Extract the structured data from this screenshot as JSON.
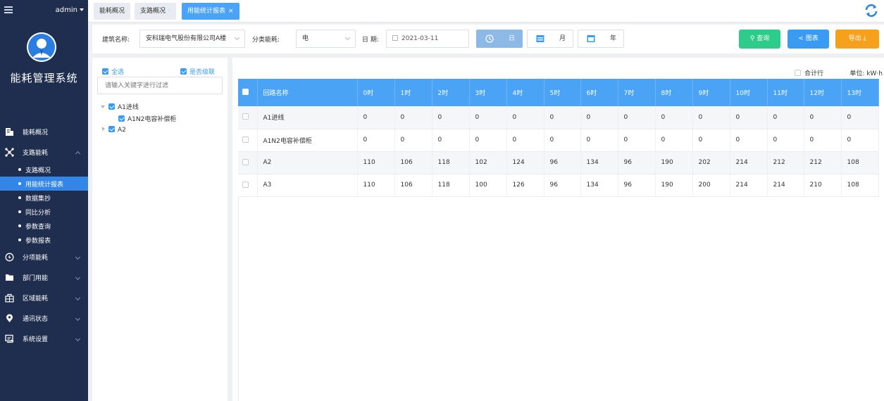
{
  "header": {
    "user": "admin"
  },
  "sidebar": {
    "title": "能耗管理系统",
    "items": [
      {
        "label": "能耗概况",
        "icon": "building-icon"
      },
      {
        "label": "支路能耗",
        "icon": "branch-icon"
      },
      {
        "label": "分项能耗",
        "icon": "power-icon"
      },
      {
        "label": "部门用能",
        "icon": "folder-icon"
      },
      {
        "label": "区域能耗",
        "icon": "region-icon"
      },
      {
        "label": "通讯状态",
        "icon": "location-icon"
      },
      {
        "label": "系统设置",
        "icon": "settings-icon"
      }
    ],
    "subitems": [
      "支路概况",
      "用能统计报表",
      "数据集抄",
      "同比分析",
      "参数查询",
      "参数报表"
    ],
    "active_subitem": "用能统计报表"
  },
  "tabs": [
    {
      "label": "能耗概况"
    },
    {
      "label": "支路概况"
    },
    {
      "label": "用能统计报表",
      "active": true
    }
  ],
  "filters": {
    "building_label": "建筑名称:",
    "building_value": "安科瑞电气股份有限公司A楼",
    "category_label": "分类能耗:",
    "category_value": "电",
    "date_label": "日 期:",
    "date_value": "2021-03-11",
    "period_day": "日",
    "period_month": "月",
    "period_year": "年",
    "query_label": "查询",
    "chart_label": "图表",
    "export_label": "导出"
  },
  "tree": {
    "select_all": "全选",
    "cascade": "是否级联",
    "filter_placeholder": "请输入关键字进行过滤",
    "nodes": [
      "A1进线",
      "A1N2电容补偿柜",
      "A2"
    ]
  },
  "table": {
    "total_row_label": "合计行",
    "unit_label": "单位:  kW·h",
    "columns": [
      "回路名称",
      "0时",
      "1时",
      "2时",
      "3时",
      "4时",
      "5时",
      "6时",
      "7时",
      "8时",
      "9时",
      "10时",
      "11时",
      "12时",
      "13时"
    ],
    "rows": [
      {
        "name": "A1进线",
        "values": [
          "0",
          "0",
          "0",
          "0",
          "0",
          "0",
          "0",
          "0",
          "0",
          "0",
          "0",
          "0",
          "0",
          "0"
        ]
      },
      {
        "name": "A1N2电容补偿柜",
        "values": [
          "0",
          "0",
          "0",
          "0",
          "0",
          "0",
          "0",
          "0",
          "0",
          "0",
          "0",
          "0",
          "0",
          "0"
        ]
      },
      {
        "name": "A2",
        "values": [
          "110",
          "106",
          "118",
          "102",
          "124",
          "96",
          "134",
          "96",
          "190",
          "202",
          "214",
          "212",
          "212",
          "108"
        ]
      },
      {
        "name": "A3",
        "values": [
          "110",
          "106",
          "118",
          "100",
          "126",
          "96",
          "134",
          "96",
          "190",
          "200",
          "214",
          "214",
          "210",
          "108"
        ]
      }
    ]
  },
  "colors": {
    "sidebar_bg": "#1f2d4e",
    "accent": "#3a9bf3",
    "header_bg": "#4aa3f5",
    "query": "#2ecc8a",
    "export": "#f5a11d"
  }
}
